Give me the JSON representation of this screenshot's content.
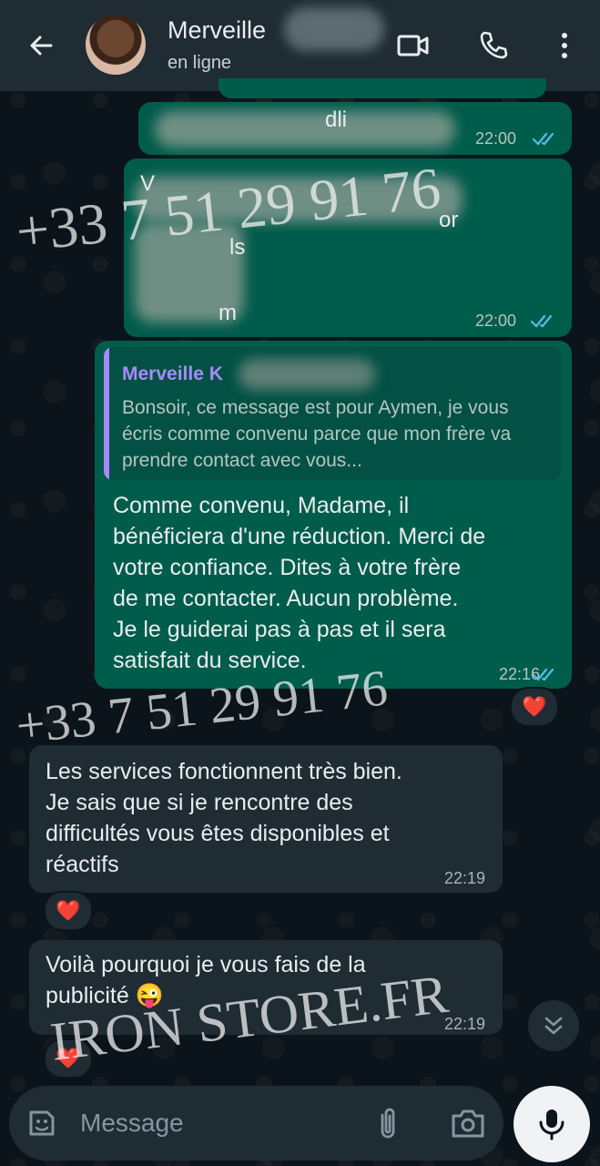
{
  "header": {
    "contact_name": "Merveille",
    "status": "en ligne"
  },
  "messages": {
    "m1_time": "22:00",
    "m1_fragment": "dli",
    "m2_time": "22:00",
    "m2_fragments": [
      "V",
      "or",
      "ls",
      "m"
    ],
    "m3_quote_author": "Merveille K",
    "m3_quote_text": "Bonsoir, ce message est pour Aymen, je vous écris comme convenu parce que mon frère va prendre contact avec vous...",
    "m3_lines": [
      "Comme convenu, Madame, il",
      "bénéficiera d'une réduction. Merci de",
      "votre confiance. Dites à votre frère",
      "de me contacter. Aucun problème.",
      "Je le guiderai pas à pas et il sera",
      "satisfait du service."
    ],
    "m3_time": "22:16",
    "m4_lines": [
      "Les services fonctionnent très bien.",
      "Je sais que si je rencontre des",
      "difficultés vous êtes disponibles et",
      "réactifs"
    ],
    "m4_time": "22:19",
    "m5_lines": [
      "Voilà pourquoi je vous fais de la",
      "publicité 😜"
    ],
    "m5_time": "22:19",
    "reaction": "❤️"
  },
  "watermarks": {
    "phone_1": "+33 7 51 29 91 76",
    "phone_2": "+33 7 51 29 91 76",
    "store": "IRON STORE.FR"
  },
  "composer": {
    "placeholder": "Message"
  },
  "icons": [
    "back-arrow-icon",
    "video-call-icon",
    "phone-call-icon",
    "more-vert-icon",
    "double-check-icon",
    "sticker-icon",
    "attach-icon",
    "camera-icon",
    "mic-icon",
    "chevron-double-down-icon"
  ]
}
